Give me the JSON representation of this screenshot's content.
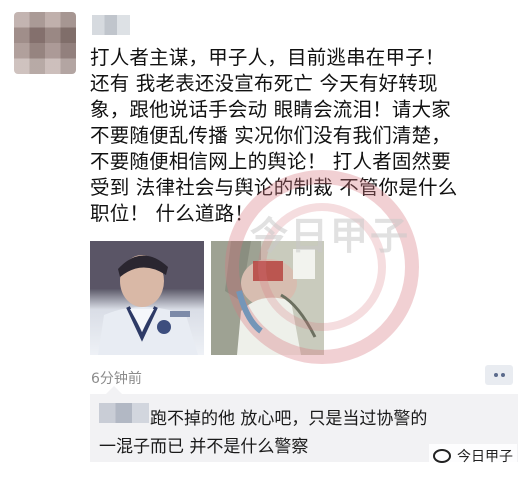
{
  "post": {
    "lines": [
      "打人者主谋，甲子人，目前逃串在甲子！",
      "还有 我老表还没宣布死亡 今天有好转现",
      "象，跟他说话手会动 眼睛会流泪！请大家",
      "不要随便乱传播 实况你们没有我们清楚，",
      "不要随便相信网上的舆论！ 打人者固然要",
      "受到 法律社会与舆论的制裁 不管你是什么",
      "职位！ 什么道路！"
    ],
    "timestamp": "6分钟前"
  },
  "watermark": {
    "text": "今日甲子"
  },
  "comment": {
    "line1": "跑不掉的他 放心吧，只是当过协警的",
    "line2": "一混子而已 并不是什么警察"
  },
  "brand": {
    "label": "今日甲子"
  }
}
